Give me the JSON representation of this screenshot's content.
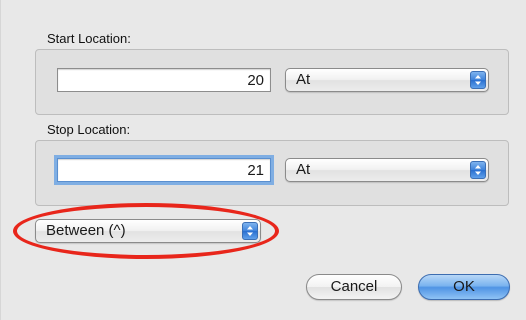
{
  "start": {
    "label": "Start Location:",
    "value": "20",
    "mode": "At"
  },
  "stop": {
    "label": "Stop Location:",
    "value": "21",
    "mode": "At"
  },
  "relation": {
    "selected": "Between (^)"
  },
  "buttons": {
    "cancel": "Cancel",
    "ok": "OK"
  },
  "colors": {
    "annotation_oval": "#e8261b",
    "focus_ring": "#7faee3",
    "default_button": "#4f93e4"
  },
  "icons": {
    "popup_arrows": "up-down-arrows-icon"
  }
}
